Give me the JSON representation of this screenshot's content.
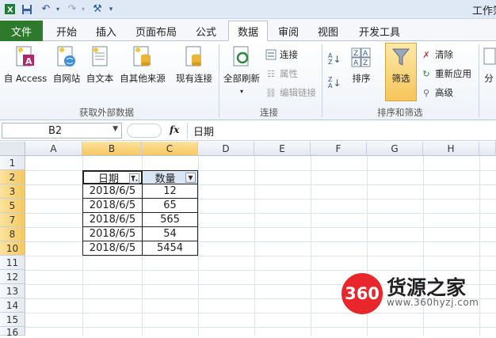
{
  "window": {
    "title": "工作簿"
  },
  "tabs": {
    "file": "文件",
    "items": [
      "开始",
      "插入",
      "页面布局",
      "公式",
      "数据",
      "审阅",
      "视图",
      "开发工具"
    ],
    "active": "数据"
  },
  "ribbon": {
    "get_external": {
      "label": "获取外部数据",
      "buttons": [
        "自 Access",
        "自网站",
        "自文本",
        "自其他来源",
        "现有连接"
      ]
    },
    "connections": {
      "label": "连接",
      "refresh_all": "全部刷新",
      "connect": "连接",
      "properties": "属性",
      "edit_links": "编辑链接"
    },
    "sort_filter": {
      "label": "排序和筛选",
      "sort": "排序",
      "filter": "筛选",
      "clear": "清除",
      "reapply": "重新应用",
      "advanced": "高级"
    },
    "extra": "分"
  },
  "formula_bar": {
    "name_box": "B2",
    "fx": "fx",
    "content": "日期"
  },
  "grid": {
    "columns": [
      "A",
      "B",
      "C",
      "D",
      "E",
      "F",
      "G",
      "H"
    ],
    "rows": [
      "1",
      "2",
      "3",
      "5",
      "7",
      "8",
      "10",
      "11",
      "12",
      "13",
      "14",
      "15",
      "16"
    ],
    "table": {
      "headers": [
        "日期",
        "数量"
      ],
      "rows": [
        [
          "2018/6/5",
          "12"
        ],
        [
          "2018/6/5",
          "65"
        ],
        [
          "2018/6/5",
          "565"
        ],
        [
          "2018/6/5",
          "54"
        ],
        [
          "2018/6/5",
          "5454"
        ]
      ]
    }
  },
  "watermark": {
    "badge": "360",
    "name": "货源之家",
    "url": "www.360hyzj.com"
  }
}
